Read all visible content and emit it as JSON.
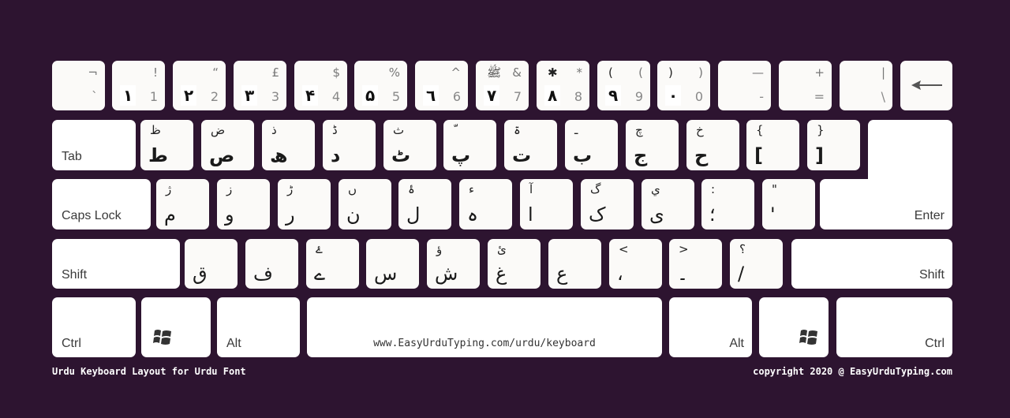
{
  "title": "Urdu Keyboard Layout for Urdu Font",
  "copyright": "copyright 2020 @ EasyUrduTyping.com",
  "space_label": "www.EasyUrduTyping.com/urdu/keyboard",
  "colors": {
    "background": "#2d1430",
    "key": "#fbfaf8"
  },
  "row1": [
    {
      "top": "¬",
      "bottom": "`"
    },
    {
      "top": "!",
      "en": "1",
      "urdu": "۱"
    },
    {
      "top": "“",
      "en": "2",
      "urdu": "۲"
    },
    {
      "top": "£",
      "en": "3",
      "urdu": "۳"
    },
    {
      "top": "$",
      "en": "4",
      "urdu": "۴"
    },
    {
      "top": "%",
      "en": "5",
      "urdu": "۵"
    },
    {
      "top": "^",
      "en": "6",
      "urdu": "٦"
    },
    {
      "top": "&",
      "urdu_top": "ﷺ",
      "en": "7",
      "urdu": "۷"
    },
    {
      "top": "*",
      "urdu_top": "✱",
      "en": "8",
      "urdu": "۸"
    },
    {
      "top": "(",
      "urdu_top": "(",
      "en": "9",
      "urdu": "۹"
    },
    {
      "top": ")",
      "urdu_top": ")",
      "en": "0",
      "urdu": "۰"
    },
    {
      "top": "—",
      "bottom": "-"
    },
    {
      "top": "+",
      "bottom": "="
    },
    {
      "top": "|",
      "bottom": "\\"
    }
  ],
  "backspace_icon": "left-arrow",
  "tab_label": "Tab",
  "row2": [
    {
      "top": "ظ",
      "main": "ط"
    },
    {
      "top": "ض",
      "main": "ص"
    },
    {
      "top": "ذ",
      "main": "ھ"
    },
    {
      "top": "ڈ",
      "main": "د"
    },
    {
      "top": "ث",
      "main": "ٹ"
    },
    {
      "top": "ّ",
      "main": "پ"
    },
    {
      "top": "ۃ",
      "main": "ت"
    },
    {
      "top": "ـ",
      "main": "ب"
    },
    {
      "top": "چ",
      "main": "ج"
    },
    {
      "top": "خ",
      "main": "ح"
    },
    {
      "top": "{",
      "main": "["
    },
    {
      "top": "}",
      "main": "]"
    }
  ],
  "caps_label": "Caps Lock",
  "enter_label": "Enter",
  "row3": [
    {
      "top": "ژ",
      "main": "م"
    },
    {
      "top": "ز",
      "main": "و"
    },
    {
      "top": "ڑ",
      "main": "ر"
    },
    {
      "top": "ں",
      "main": "ن"
    },
    {
      "top": "ۂ",
      "main": "ل"
    },
    {
      "top": "ء",
      "main": "ہ"
    },
    {
      "top": "آ",
      "main": "ا"
    },
    {
      "top": "گ",
      "main": "ک"
    },
    {
      "top": "ي",
      "main": "ی"
    },
    {
      "top": ":",
      "main": "؛"
    },
    {
      "top": "\"",
      "main": "'"
    }
  ],
  "shift_label": "Shift",
  "row4": [
    {
      "top": "",
      "main": "ق"
    },
    {
      "top": "",
      "main": "ف"
    },
    {
      "top": "ۓ",
      "main": "ے"
    },
    {
      "top": "",
      "main": "س"
    },
    {
      "top": "ؤ",
      "main": "ش"
    },
    {
      "top": "ئ",
      "main": "غ"
    },
    {
      "top": "",
      "main": "ع"
    },
    {
      "top": "<",
      "main": "،"
    },
    {
      "top": ">",
      "main": "۔"
    },
    {
      "top": "؟",
      "main": "/"
    }
  ],
  "ctrl_label": "Ctrl",
  "alt_label": "Alt"
}
